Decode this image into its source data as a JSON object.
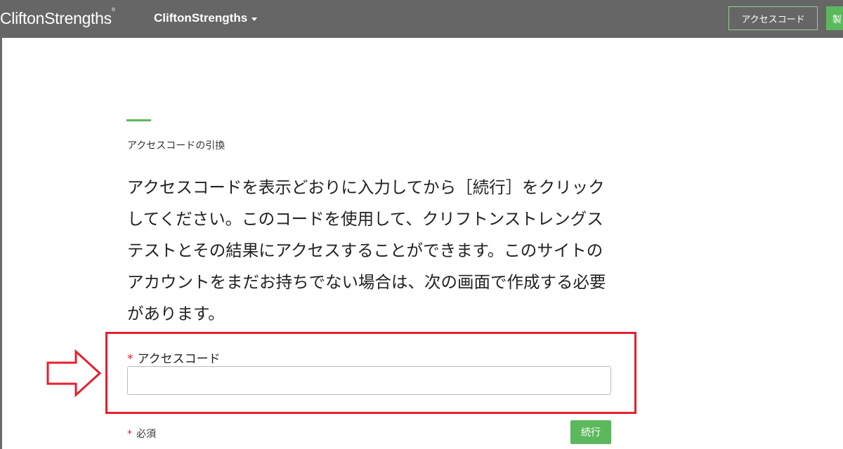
{
  "header": {
    "logo_text": "CliftonStrengths",
    "logo_mark": "®",
    "product_menu_label": "CliftonStrengths",
    "access_code_button": "アクセスコード",
    "buy_button": "製"
  },
  "main": {
    "section_title": "アクセスコードの引換",
    "instructions": "アクセスコードを表示どおりに入力してから［続行］をクリックしてください。このコードを使用して、クリフトンストレングステストとその結果にアクセスすることができます。このサイトのアカウントをまだお持ちでない場合は、次の画面で作成する必要があります。",
    "form": {
      "required_marker": "*",
      "field_label": "アクセスコード",
      "field_value": "",
      "required_note": "必須",
      "continue_button": "続行"
    }
  },
  "colors": {
    "topbar": "#666666",
    "accent_green": "#5cb85c",
    "highlight_red": "#e5202e"
  }
}
